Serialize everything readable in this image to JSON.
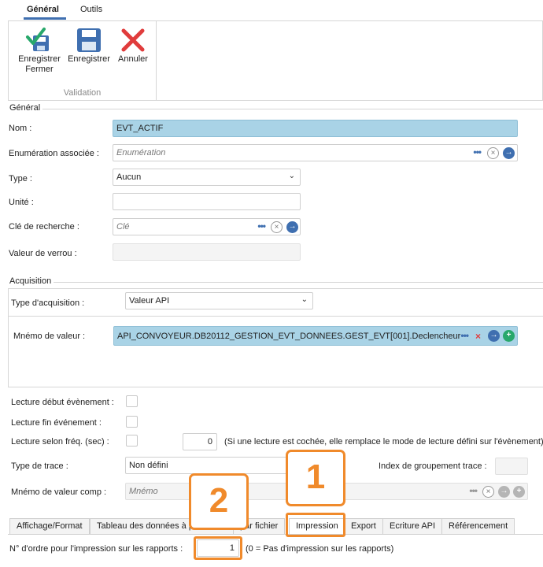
{
  "ribbon": {
    "tabs": [
      "Général",
      "Outils"
    ],
    "buttons": {
      "save_close": [
        "Enregistrer",
        "Fermer"
      ],
      "save": "Enregistrer",
      "cancel": "Annuler"
    },
    "group_label": "Validation"
  },
  "general": {
    "title": "Général",
    "nom": {
      "label": "Nom :",
      "value": "EVT_ACTIF"
    },
    "enum": {
      "label": "Enumération associée :",
      "placeholder": "Enumération"
    },
    "type": {
      "label": "Type :",
      "value": "Aucun"
    },
    "unite": {
      "label": "Unité :",
      "value": ""
    },
    "cle": {
      "label": "Clé de recherche :",
      "placeholder": "Clé"
    },
    "verrou": {
      "label": "Valeur de verrou :",
      "value": ""
    }
  },
  "acquisition": {
    "title": "Acquisition",
    "type": {
      "label": "Type d'acquisition :",
      "value": "Valeur API"
    },
    "mnemo": {
      "label": "Mnémo de valeur :",
      "value": "API_CONVOYEUR.DB20112_GESTION_EVT_DONNEES.GEST_EVT[001].Declencheur"
    },
    "lecture_debut": "Lecture début évènement :",
    "lecture_fin": "Lecture fin événement :",
    "lecture_freq": {
      "label": "Lecture selon fréq. (sec) :",
      "value": "0",
      "note": "(Si une lecture est cochée, elle remplace le mode de lecture défini sur l'évènement)"
    },
    "trace": {
      "label": "Type de trace :",
      "value": "Non défini"
    },
    "index_trace": "Index de groupement trace :",
    "mnemo_comp": {
      "label": "Mnémo de valeur comp :",
      "placeholder": "Mnémo"
    }
  },
  "tabs": {
    "affichage": "Affichage/Format",
    "tableau": "Tableau des données à p",
    "fichier": "par fichier",
    "impression": "Impression",
    "export": "Export",
    "ecriture": "Ecriture API",
    "referencement": "Référencement"
  },
  "impression": {
    "ordre_label": "N° d'ordre pour l'impression sur les rapports :",
    "ordre_value": "1",
    "note": "(0 = Pas d'impression sur les rapports)"
  },
  "annotations": {
    "one": "1",
    "two": "2"
  },
  "colors": {
    "accent": "#f08a2b",
    "highlight": "#a9d3e6",
    "blue": "#3f6fb0"
  }
}
